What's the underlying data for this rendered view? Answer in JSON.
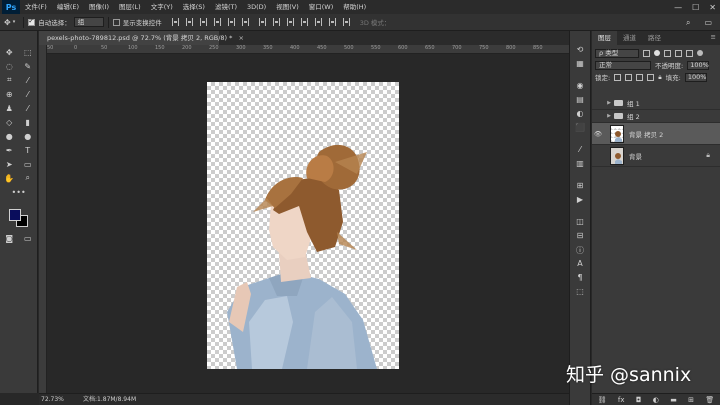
{
  "app_logo": "Ps",
  "menu": [
    "文件(F)",
    "编辑(E)",
    "图像(I)",
    "图层(L)",
    "文字(Y)",
    "选择(S)",
    "滤镜(T)",
    "3D(D)",
    "视图(V)",
    "窗口(W)",
    "帮助(H)"
  ],
  "window_controls": [
    "—",
    "☐",
    "✕"
  ],
  "options": {
    "auto_select_label": "自动选择：",
    "auto_select_value": "组",
    "show_transform_label": "显示变换控件",
    "mode_3d_label": "3D 模式："
  },
  "document": {
    "tab_title": "pexels-photo-789812.psd @ 72.7% (背景 拷贝 2, RGB/8) *",
    "close_glyph": "×"
  },
  "ruler_labels": [
    "50",
    "0",
    "50",
    "100",
    "150",
    "200",
    "250",
    "300",
    "350",
    "400",
    "450",
    "500",
    "550",
    "600",
    "650",
    "700",
    "750",
    "800",
    "850"
  ],
  "status": {
    "zoom": "72.73%",
    "doc_info": "文档:1.87M/8.94M"
  },
  "layers_panel": {
    "tabs": [
      "图层",
      "通道",
      "路径"
    ],
    "filter_label": "ρ 类型",
    "blend_mode": "正常",
    "opacity_label": "不透明度:",
    "opacity_value": "100%",
    "lock_label": "锁定:",
    "fill_label": "填充:",
    "fill_value": "100%",
    "layers": [
      {
        "name": "组 1",
        "type": "group",
        "visible": false,
        "selected": false
      },
      {
        "name": "组 2",
        "type": "group",
        "visible": false,
        "selected": false
      },
      {
        "name": "背景 拷贝 2",
        "type": "pixel",
        "visible": true,
        "selected": true
      },
      {
        "name": "背景",
        "type": "pixel",
        "visible": false,
        "selected": false,
        "locked": true
      }
    ]
  },
  "colors": {
    "foreground": "#0a0d5c",
    "background": "#000000"
  },
  "watermark": "知乎 @sannix"
}
